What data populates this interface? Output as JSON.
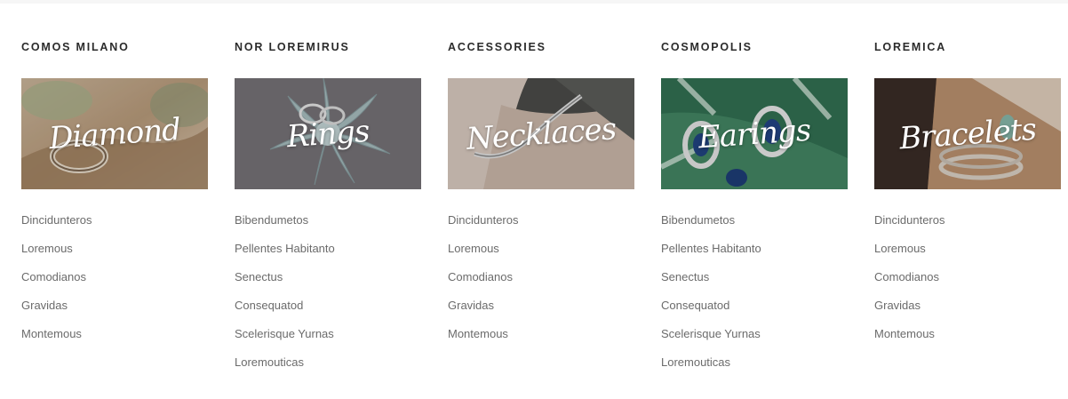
{
  "colors": {
    "title": "#2b2b2b",
    "link": "#6b6b6b",
    "banner_text": "#ffffff"
  },
  "columns": [
    {
      "title": "COMOS MILANO",
      "banner": {
        "label": "Diamond",
        "photo": "ring-on-driftwood"
      },
      "links": [
        "Dincidunteros",
        "Loremous",
        "Comodianos",
        "Gravidas",
        "Montemous"
      ]
    },
    {
      "title": "NOR LOREMIRUS",
      "banner": {
        "label": "Rings",
        "photo": "rings-on-succulent"
      },
      "links": [
        "Bibendumetos",
        "Pellentes Habitanto",
        "Senectus",
        "Consequatod",
        "Scelerisque Yurnas",
        "Loremouticas"
      ]
    },
    {
      "title": "ACCESSORIES",
      "banner": {
        "label": "Necklaces",
        "photo": "bracelet-on-wrist"
      },
      "links": [
        "Dincidunteros",
        "Loremous",
        "Comodianos",
        "Gravidas",
        "Montemous"
      ]
    },
    {
      "title": "COSMOPOLIS",
      "banner": {
        "label": "Earings",
        "photo": "earrings-on-leaf"
      },
      "links": [
        "Bibendumetos",
        "Pellentes Habitanto",
        "Senectus",
        "Consequatod",
        "Scelerisque Yurnas",
        "Loremouticas"
      ]
    },
    {
      "title": "LOREMICA",
      "banner": {
        "label": "Bracelets",
        "photo": "bracelets-on-arm"
      },
      "links": [
        "Dincidunteros",
        "Loremous",
        "Comodianos",
        "Gravidas",
        "Montemous"
      ]
    }
  ]
}
